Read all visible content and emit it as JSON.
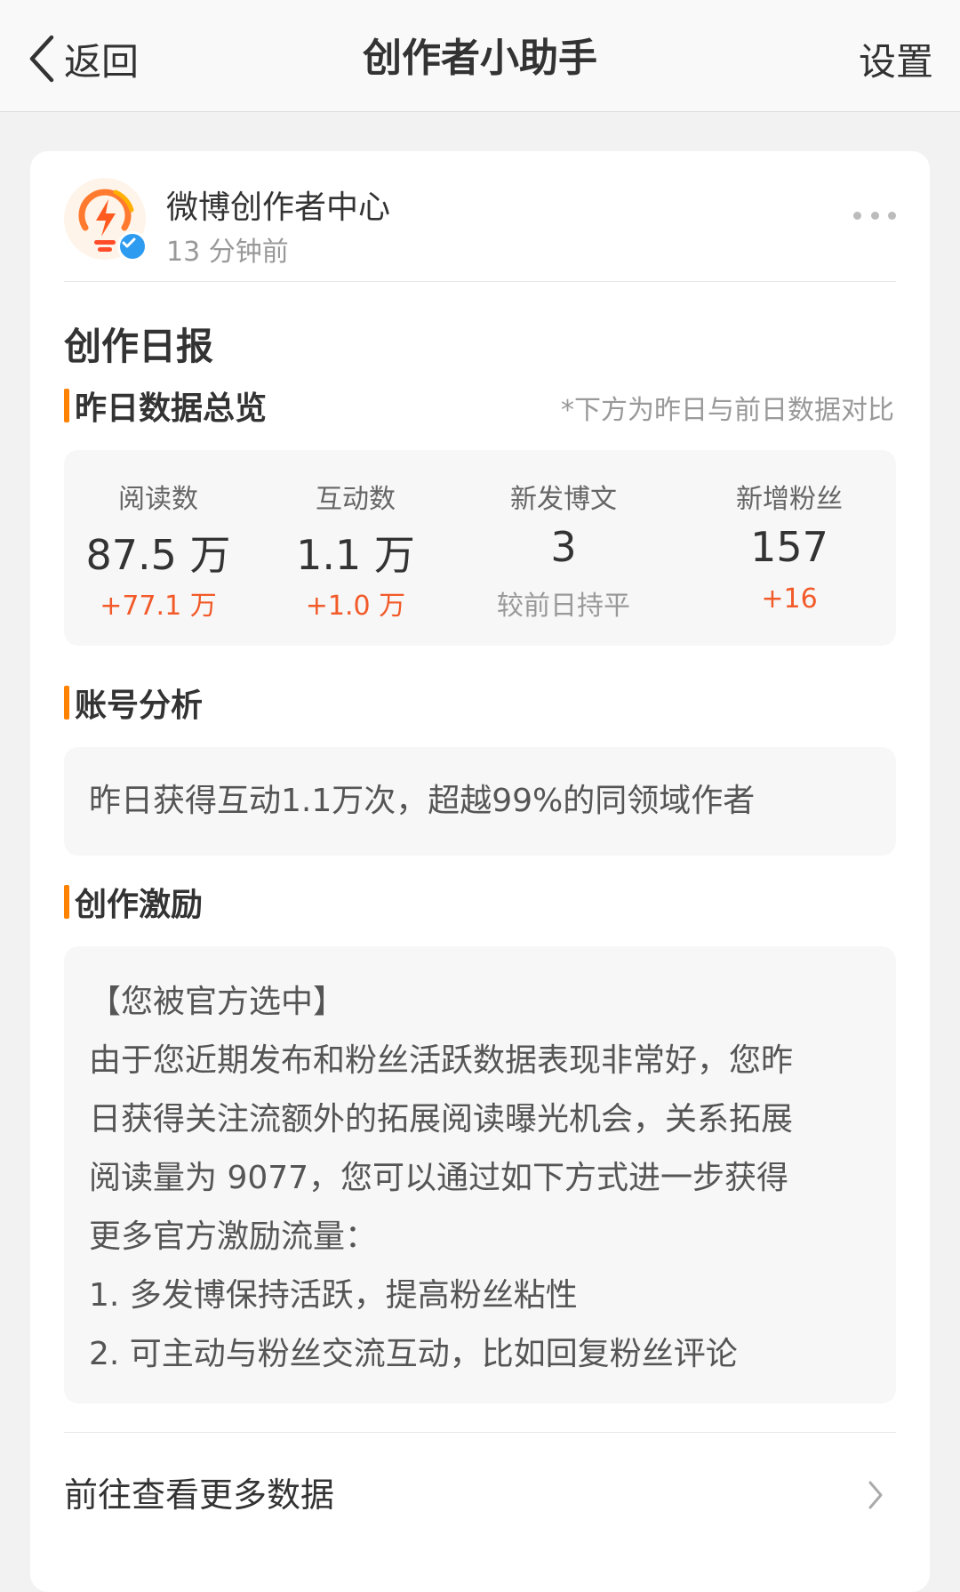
{
  "nav": {
    "back_label": "返回",
    "title": "创作者小助手",
    "settings_label": "设置"
  },
  "post": {
    "account_name": "微博创作者中心",
    "time": "13 分钟前",
    "daily_title": "创作日报",
    "overview": {
      "heading": "昨日数据总览",
      "note": "*下方为昨日与前日数据对比",
      "stats": [
        {
          "label": "阅读数",
          "value": "87.5 万",
          "delta": "+77.1 万"
        },
        {
          "label": "互动数",
          "value": "1.1 万",
          "delta": "+1.0 万"
        },
        {
          "label": "新发博文",
          "value": "3",
          "delta": "较前日持平"
        },
        {
          "label": "新增粉丝",
          "value": "157",
          "delta": "+16"
        }
      ]
    },
    "analysis": {
      "heading": "账号分析",
      "text": "昨日获得互动1.1万次，超越99%的同领域作者"
    },
    "incentive": {
      "heading": "创作激励",
      "lines": [
        "【您被官方选中】",
        "由于您近期发布和粉丝活跃数据表现非常好，您昨",
        "日获得关注流额外的拓展阅读曝光机会，关系拓展",
        "阅读量为 9077，您可以通过如下方式进一步获得",
        "更多官方激励流量：",
        "1. 多发博保持活跃，提高粉丝粘性",
        "2. 可主动与粉丝交流互动，比如回复粉丝评论"
      ]
    },
    "more_data_label": "前往查看更多数据"
  },
  "colors": {
    "accent": "#ff8200",
    "delta_up": "#f25a29",
    "verified": "#2d9bf0"
  }
}
